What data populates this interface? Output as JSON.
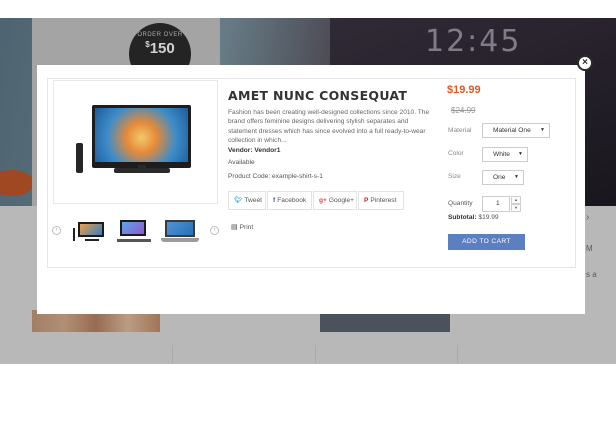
{
  "background": {
    "badge_small": "ORDER OVER",
    "badge_amount": "150",
    "badge_currency": "$",
    "clock": "12:45",
    "carousel_next": "›",
    "fragment_1": "M",
    "fragment_2": "s a"
  },
  "modal": {
    "close_label": "×",
    "product": {
      "title": "AMET NUNC CONSEQUAT",
      "description": "Fashion has been creating well-designed collections since 2010. The brand offers feminine designs delivering stylish separates and statement dresses which has since evolved into a full ready-to-wear collection in which...",
      "vendor": "Vendor: Vendor1",
      "availability": "Available",
      "product_code": "Product Code: example-shirt-s-1",
      "price": "$19.99",
      "compare_price": "$24.99"
    },
    "share": {
      "tweet": "Tweet",
      "facebook": "Facebook",
      "google": "Google+",
      "pinterest": "Pinterest",
      "print": "Print"
    },
    "options": {
      "material_label": "Material",
      "material_value": "Material One",
      "color_label": "Color",
      "color_value": "White",
      "size_label": "Size",
      "size_value": "One"
    },
    "quantity": {
      "label": "Quantity",
      "value": "1"
    },
    "subtotal": {
      "label": "Subtotal:",
      "value": "$19.99"
    },
    "add_to_cart": "ADD TO CART",
    "colors": {
      "price": "#e25a22",
      "button": "#5b7fc1"
    }
  }
}
